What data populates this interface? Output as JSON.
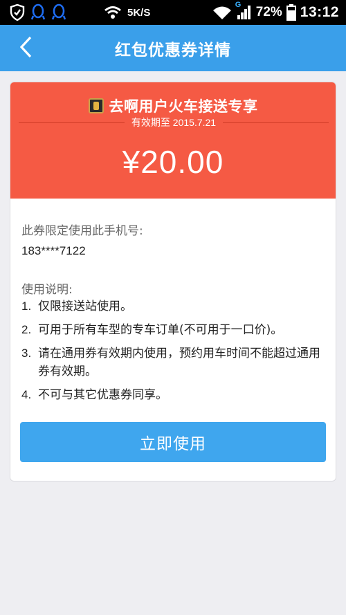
{
  "status_bar": {
    "network_speed": "5K/S",
    "signal_label": "G",
    "battery": "72%",
    "time": "13:12"
  },
  "header": {
    "title": "红包优惠券详情"
  },
  "coupon": {
    "title": "去啊用户火车接送专享",
    "validity": "有效期至 2015.7.21",
    "amount": "¥20.00",
    "accent_color": "#f55a44"
  },
  "details": {
    "phone_label": "此券限定使用此手机号:",
    "phone": "183****7122",
    "instructions_label": "使用说明:",
    "rules": [
      {
        "num": "1.",
        "text": "仅限接送站使用。"
      },
      {
        "num": "2.",
        "text": "可用于所有车型的专车订单(不可用于一口价)。"
      },
      {
        "num": "3.",
        "text": "请在通用券有效期内使用，预约用车时间不能超过通用券有效期。"
      },
      {
        "num": "4.",
        "text": "不可与其它优惠券同享。"
      }
    ]
  },
  "actions": {
    "use_now": "立即使用"
  }
}
